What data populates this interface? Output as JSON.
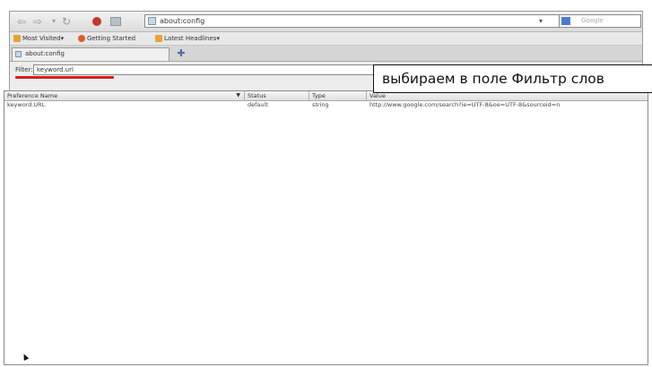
{
  "toolbar": {
    "back_icon": "back-arrow-icon",
    "forward_icon": "forward-arrow-icon",
    "url": "about:config",
    "search_placeholder": "Google"
  },
  "bookmarks": [
    {
      "label": "Most Visited▾",
      "icon": "star-folder-icon",
      "color": "#e3a52f"
    },
    {
      "label": "Getting Started",
      "icon": "firefox-icon",
      "color": "#d9602a"
    },
    {
      "label": "Latest Headlines▾",
      "icon": "rss-icon",
      "color": "#e9a33b"
    }
  ],
  "tabs": [
    {
      "label": "about:config"
    }
  ],
  "filter": {
    "label": "Filter:",
    "value": "keyword.url"
  },
  "table": {
    "headers": [
      "Preference Name",
      "Status",
      "Type",
      "Value"
    ],
    "rows": [
      {
        "name": "keyword.URL",
        "status": "default",
        "type": "string",
        "value": "http://www.google.com/search?ie=UTF-8&oe=UTF-8&sourceid=n"
      }
    ]
  },
  "annotation": {
    "text": "выбираем в поле Фильтр слов"
  },
  "colors": {
    "highlight": "#d42020"
  }
}
